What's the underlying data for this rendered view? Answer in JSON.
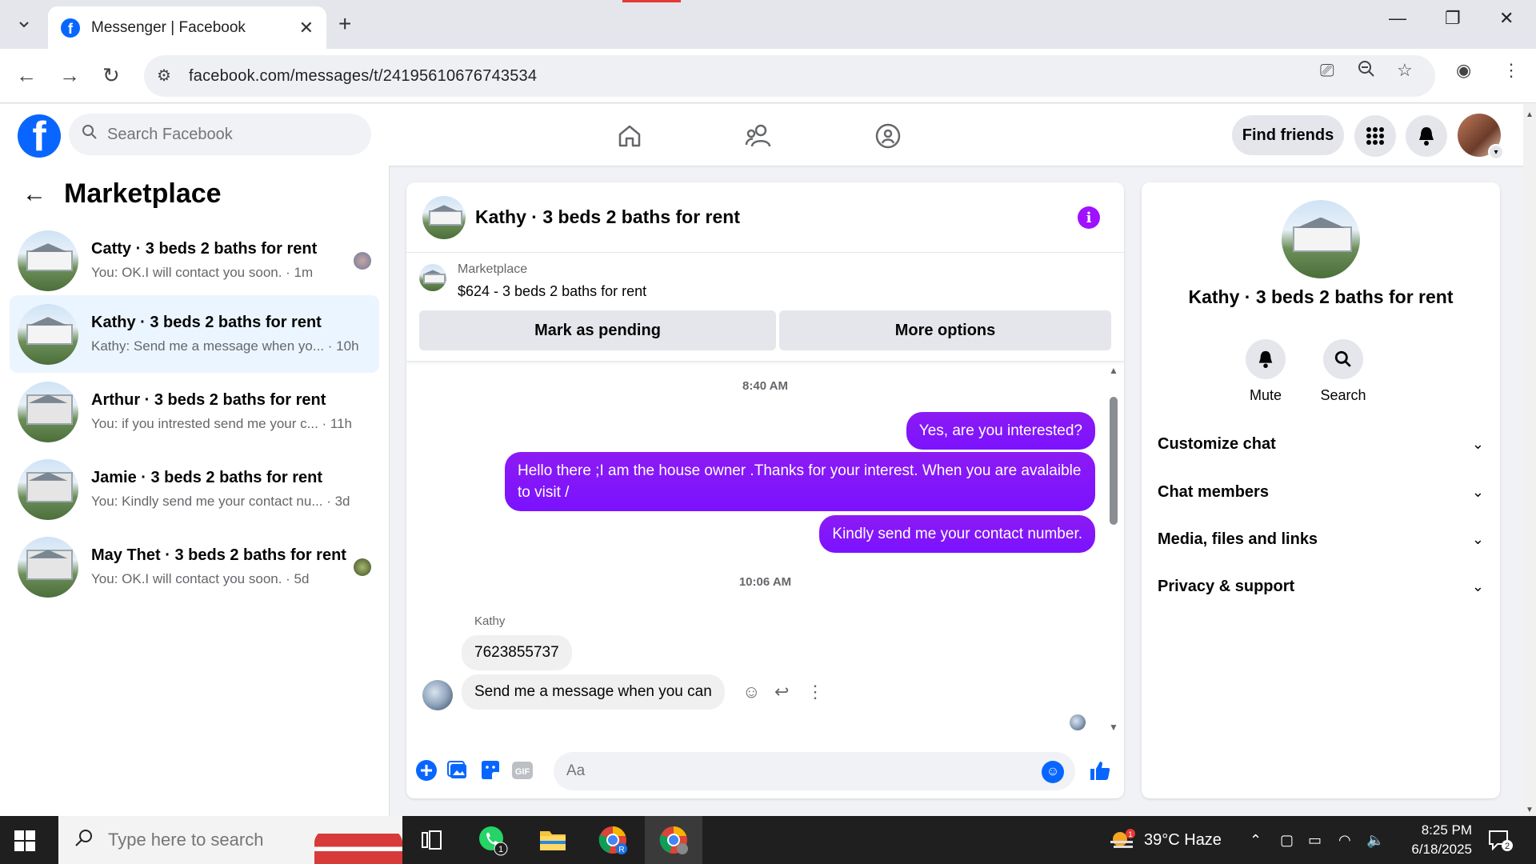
{
  "browser": {
    "tab_title": "Messenger | Facebook",
    "url": "facebook.com/messages/t/24195610676743534"
  },
  "header": {
    "search_placeholder": "Search Facebook",
    "find_friends": "Find friends"
  },
  "sidebar": {
    "title": "Marketplace",
    "conversations": [
      {
        "name": "Catty · 3 beds 2 baths for rent",
        "preview": "You: OK.I will contact you soon. · 1m"
      },
      {
        "name": "Kathy · 3 beds 2 baths for rent",
        "preview": "Kathy: Send me a message when yo... · 10h"
      },
      {
        "name": "Arthur · 3 beds 2 baths for rent",
        "preview": "You: if you intrested send me your c... · 11h"
      },
      {
        "name": "Jamie · 3 beds 2 baths for rent",
        "preview": "You: Kindly send me your contact nu... · 3d"
      },
      {
        "name": "May Thet · 3 beds 2 baths for rent",
        "preview": "You: OK.I will contact you soon. · 5d"
      }
    ]
  },
  "chat": {
    "title": "Kathy · 3 beds 2 baths for rent",
    "listing_source": "Marketplace",
    "listing_price": "$624 - 3 beds 2 baths for rent",
    "mark_pending": "Mark as pending",
    "more_options": "More options",
    "timestamp_1": "8:40 AM",
    "timestamp_2": "10:06 AM",
    "messages_out": [
      "Yes, are you interested?",
      "Hello there ;I am the house owner .Thanks for your interest. When you are avalaible to visit /",
      "Kindly send me your contact number."
    ],
    "sender_name": "Kathy",
    "messages_in": [
      "7623855737",
      "Send me a message when you can"
    ],
    "composer_placeholder": "Aa"
  },
  "details": {
    "name": "Kathy · 3 beds 2 baths for rent",
    "mute": "Mute",
    "search": "Search",
    "sections": [
      "Customize chat",
      "Chat members",
      "Media, files and links",
      "Privacy & support"
    ]
  },
  "taskbar": {
    "search_placeholder": "Type here to search",
    "weather": "39°C  Haze",
    "weather_badge": "1",
    "whatsapp_badge": "1",
    "time": "8:25 PM",
    "date": "6/18/2025",
    "notifications": "2"
  },
  "colors": {
    "fb_blue": "#0866ff",
    "outgoing_bubble": "#8a14ff",
    "active_conversation": "#ebf5ff"
  }
}
